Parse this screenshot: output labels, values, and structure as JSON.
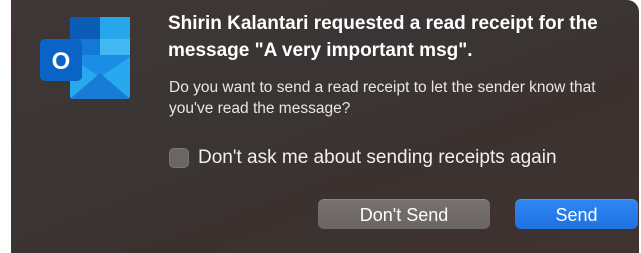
{
  "dialog": {
    "app_icon": "outlook-icon",
    "app_icon_letter": "O",
    "title": "Shirin Kalantari requested a read receipt for the message \"A very important msg\".",
    "message": "Do you want to send a read receipt to let the sender know that you've read the message?",
    "checkbox": {
      "label": "Don't ask me about sending receipts again",
      "checked": false
    },
    "buttons": {
      "dont_send_label": "Don't Send",
      "send_label": "Send"
    }
  },
  "colors": {
    "dialog_background": "#3b3432",
    "primary_button": "#2279e8",
    "secondary_button": "#6f6967",
    "outlook_blue": "#0a64c6"
  }
}
